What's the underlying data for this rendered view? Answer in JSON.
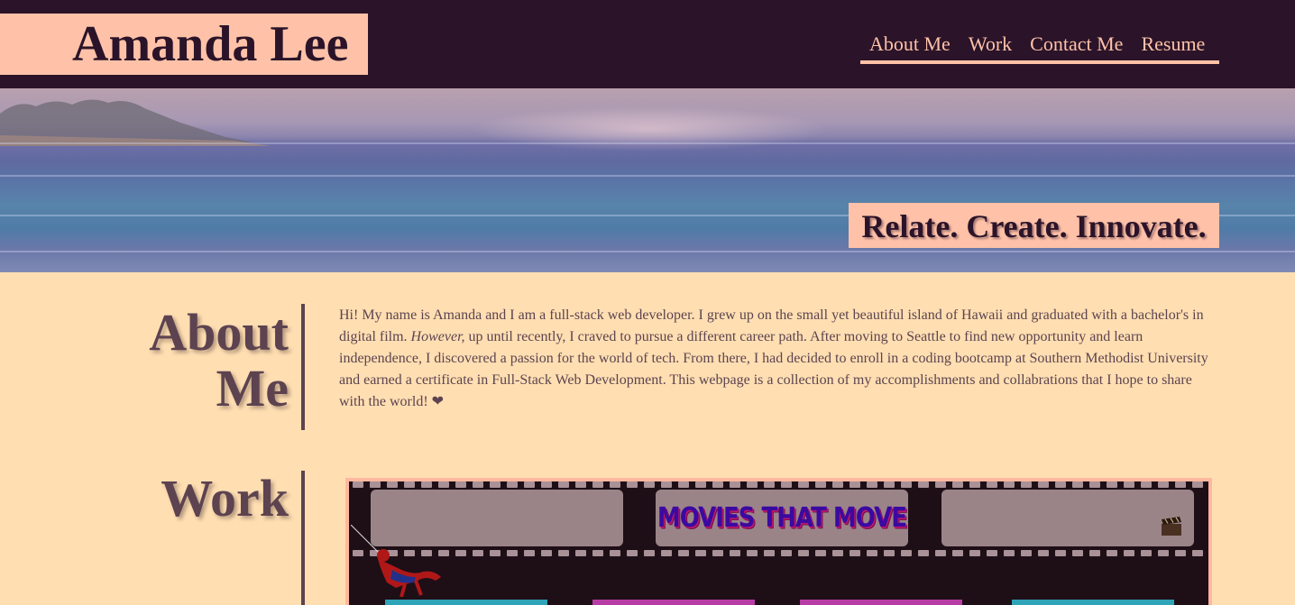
{
  "header": {
    "brand": "Amanda Lee",
    "nav": [
      {
        "label": "About Me"
      },
      {
        "label": "Work"
      },
      {
        "label": "Contact Me"
      },
      {
        "label": "Resume"
      }
    ]
  },
  "hero": {
    "tagline": "Relate. Create. Innovate."
  },
  "about": {
    "title_line1": "About",
    "title_line2": "Me",
    "text_part1": "Hi! My name is Amanda and I am a full-stack web developer. I grew up on the small yet beautiful island of Hawaii and graduated with a bachelor's in digital film. ",
    "text_em": "However,",
    "text_part2": " up until recently, I craved to pursue a different career path. After moving to Seattle to find new opportunity and learn independence, I discovered a passion for the world of tech. From there, I had decided to enroll in a coding bootcamp at Southern Methodist University and earned a certificate in Full-Stack Web Development. This webpage is a collection of my accomplishments and collabrations that I hope to share with the world! ",
    "heart": "❤"
  },
  "work": {
    "title": "Work",
    "project_title": "MOVIES THAT MOVE"
  },
  "colors": {
    "header_bg": "#2b1429",
    "accent": "#ffc2a8",
    "page_bg": "#ffdfb2",
    "text": "#5d4350"
  }
}
